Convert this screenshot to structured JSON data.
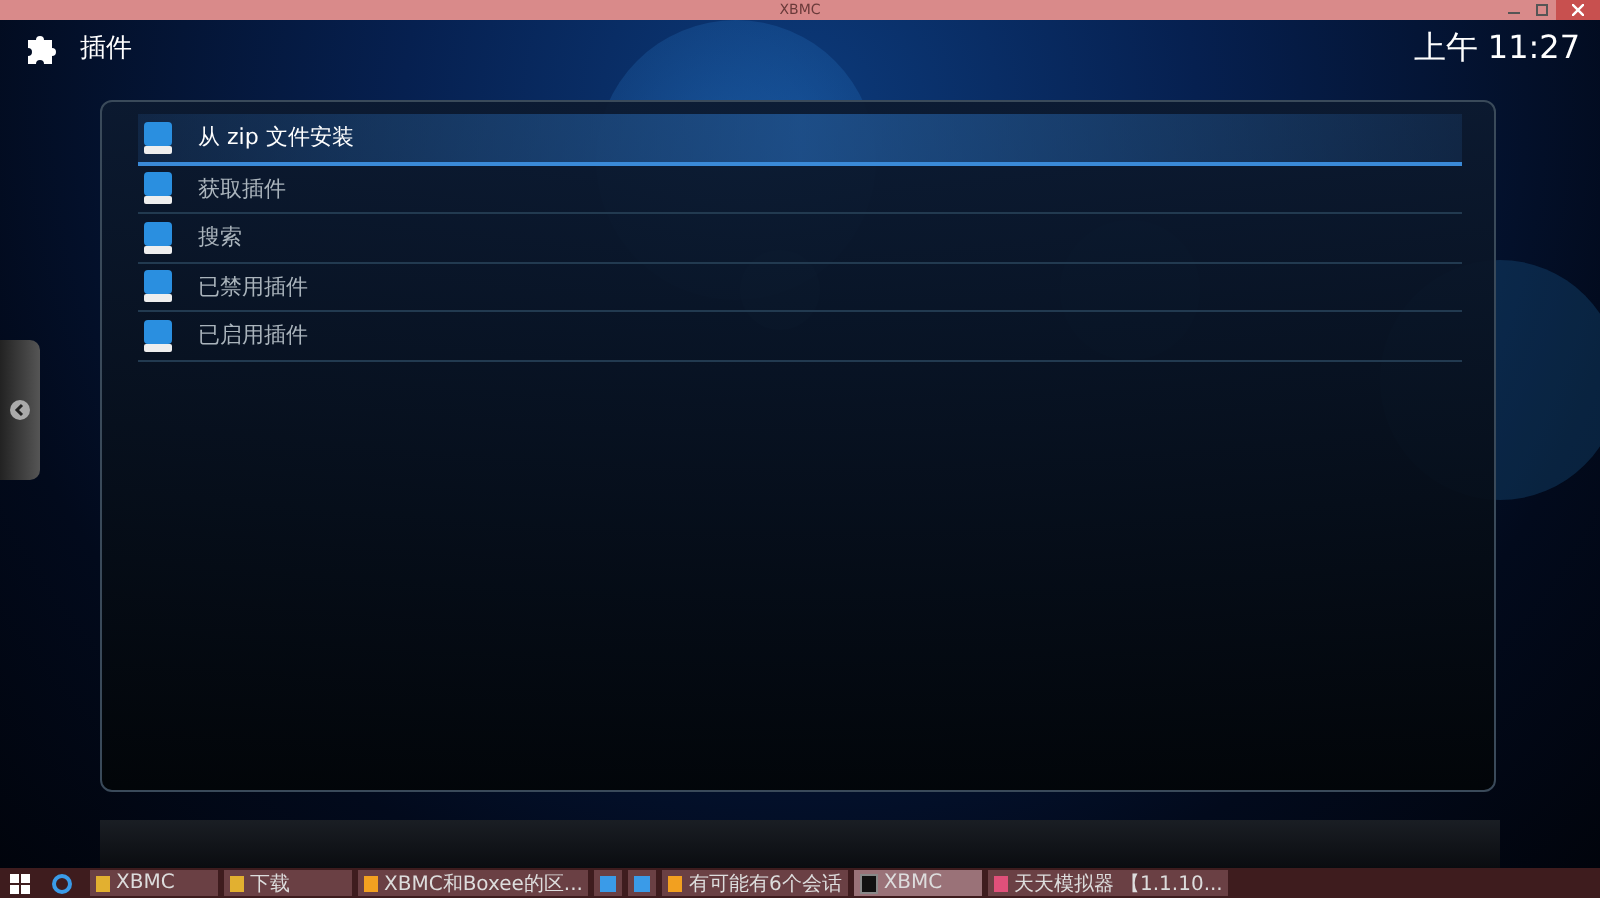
{
  "window": {
    "title": "XBMC"
  },
  "header": {
    "title": "插件",
    "clock": "上午 11:27"
  },
  "menu": {
    "items": [
      {
        "label": "从 zip 文件安装",
        "selected": true
      },
      {
        "label": "获取插件",
        "selected": false
      },
      {
        "label": "搜索",
        "selected": false
      },
      {
        "label": "已禁用插件",
        "selected": false
      },
      {
        "label": "已启用插件",
        "selected": false
      }
    ]
  },
  "taskbar": {
    "items": [
      {
        "label": "XBMC",
        "kind": "folder",
        "selected": false
      },
      {
        "label": "下载",
        "kind": "folder",
        "selected": false
      },
      {
        "label": "XBMC和Boxee的区...",
        "kind": "app",
        "selected": false
      },
      {
        "kind": "icon",
        "selected": false
      },
      {
        "kind": "icon",
        "selected": false
      },
      {
        "label": "有可能有6个会话",
        "kind": "app",
        "selected": false
      },
      {
        "label": "XBMC",
        "kind": "xbmc",
        "selected": true
      },
      {
        "label": "天天模拟器 【1.1.10...",
        "kind": "emulator",
        "selected": false
      }
    ]
  }
}
